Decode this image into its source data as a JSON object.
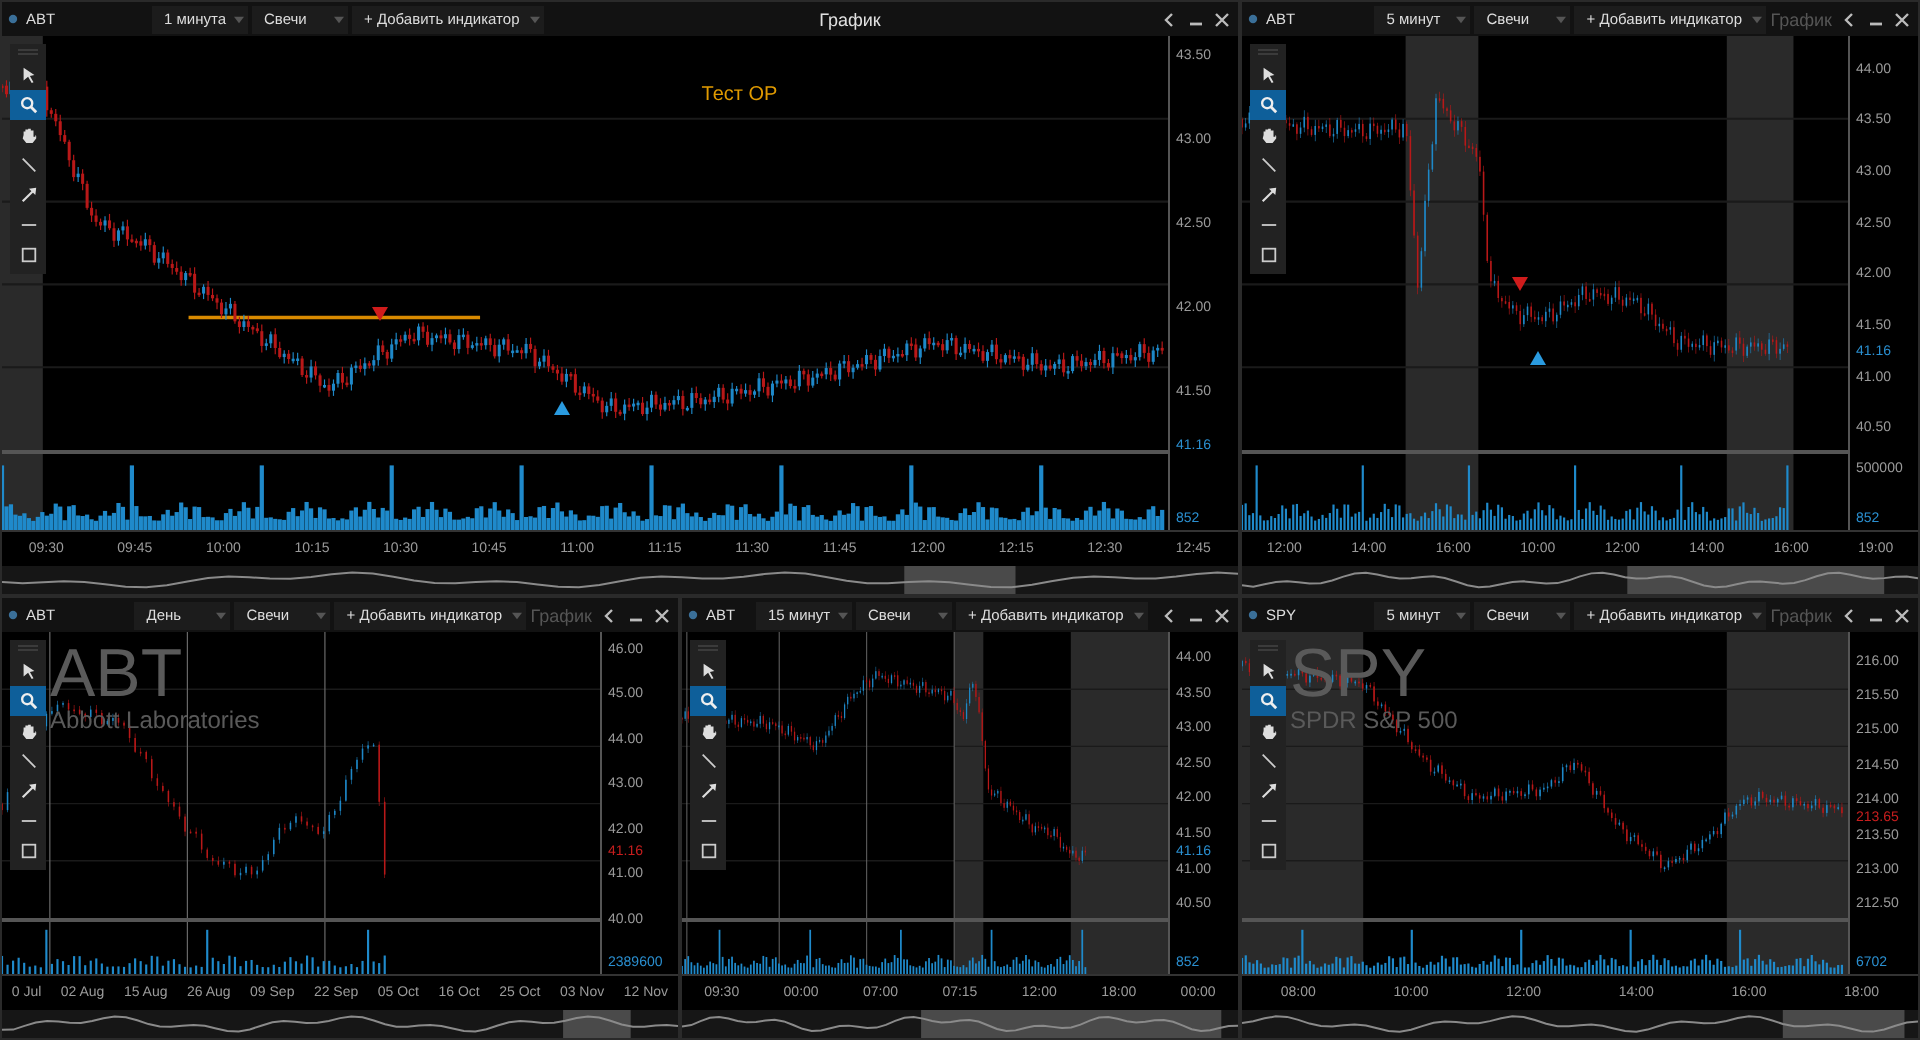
{
  "panels": [
    {
      "symbol": "ABT",
      "interval": "1 минута",
      "chart_type": "Свечи",
      "add_indicator": "+ Добавить индикатор",
      "title": "График",
      "focused": true,
      "tools": [
        {
          "kind": "cursor",
          "selected": false
        },
        {
          "kind": "zoom",
          "selected": true
        },
        {
          "kind": "hand",
          "selected": false
        },
        {
          "kind": "line",
          "selected": false
        },
        {
          "kind": "arrow",
          "selected": false
        },
        {
          "kind": "hline",
          "selected": false
        },
        {
          "kind": "rect",
          "selected": false
        }
      ],
      "price_ticks": [
        "43.50",
        "43.00",
        "42.50",
        "42.00",
        "41.50"
      ],
      "last_price": {
        "text": "41.16",
        "falling": false
      },
      "volume_ticks": [
        "852"
      ],
      "time_ticks": [
        "09:30",
        "09:45",
        "10:00",
        "10:15",
        "10:30",
        "10:45",
        "11:00",
        "11:15",
        "11:30",
        "11:45",
        "12:00",
        "12:15",
        "12:30",
        "12:45"
      ],
      "annotation": "Тест OP"
    },
    {
      "symbol": "ABT",
      "interval": "5 минут",
      "chart_type": "Свечи",
      "add_indicator": "+ Добавить индикатор",
      "title": "График",
      "focused": false,
      "tools": [
        {
          "kind": "cursor",
          "selected": false
        },
        {
          "kind": "zoom",
          "selected": true
        },
        {
          "kind": "hand",
          "selected": false
        },
        {
          "kind": "line",
          "selected": false
        },
        {
          "kind": "arrow",
          "selected": false
        },
        {
          "kind": "hline",
          "selected": false
        },
        {
          "kind": "rect",
          "selected": false
        }
      ],
      "price_ticks": [
        "44.00",
        "43.50",
        "43.00",
        "42.50",
        "42.00",
        "41.50",
        "41.00",
        "40.50"
      ],
      "last_price": {
        "text": "41.16",
        "falling": false
      },
      "volume_ticks": [
        "500000",
        "852"
      ],
      "time_ticks": [
        "12:00",
        "14:00",
        "16:00",
        "10:00",
        "12:00",
        "14:00",
        "16:00",
        "19:00"
      ]
    },
    {
      "symbol": "ABT",
      "interval": "День",
      "chart_type": "Свечи",
      "add_indicator": "+ Добавить индикатор",
      "title": "График",
      "focused": false,
      "tools": [
        {
          "kind": "cursor",
          "selected": false
        },
        {
          "kind": "zoom",
          "selected": true
        },
        {
          "kind": "hand",
          "selected": false
        },
        {
          "kind": "line",
          "selected": false
        },
        {
          "kind": "arrow",
          "selected": false
        },
        {
          "kind": "hline",
          "selected": false
        },
        {
          "kind": "rect",
          "selected": false
        }
      ],
      "watermark": {
        "symbol": "ABT",
        "name": "Abbott Laboratories"
      },
      "price_ticks": [
        "46.00",
        "45.00",
        "44.00",
        "43.00",
        "42.00",
        "41.00",
        "40.00"
      ],
      "last_price": {
        "text": "41.16",
        "falling": true
      },
      "volume_ticks": [
        "2389600"
      ],
      "time_ticks": [
        "0 Jul",
        "02 Aug",
        "15 Aug",
        "26 Aug",
        "09 Sep",
        "22 Sep",
        "05 Oct",
        "16 Oct",
        "25 Oct",
        "03 Nov",
        "12 Nov"
      ]
    },
    {
      "symbol": "ABT",
      "interval": "15 минут",
      "chart_type": "Свечи",
      "add_indicator": "+ Добавить индикатор",
      "tools": [
        {
          "kind": "cursor",
          "selected": false
        },
        {
          "kind": "zoom",
          "selected": true
        },
        {
          "kind": "hand",
          "selected": false
        },
        {
          "kind": "line",
          "selected": false
        },
        {
          "kind": "arrow",
          "selected": false
        },
        {
          "kind": "hline",
          "selected": false
        },
        {
          "kind": "rect",
          "selected": false
        }
      ],
      "price_ticks": [
        "44.00",
        "43.50",
        "43.00",
        "42.50",
        "42.00",
        "41.50",
        "41.00",
        "40.50"
      ],
      "last_price": {
        "text": "41.16",
        "falling": false
      },
      "volume_ticks": [
        "852"
      ],
      "time_ticks": [
        "09:30",
        "00:00",
        "07:00",
        "07:15",
        "12:00",
        "18:00",
        "00:00"
      ]
    },
    {
      "symbol": "SPY",
      "interval": "5 минут",
      "chart_type": "Свечи",
      "add_indicator": "+ Добавить индикатор",
      "title": "График",
      "focused": false,
      "tools": [
        {
          "kind": "cursor",
          "selected": false
        },
        {
          "kind": "zoom",
          "selected": true
        },
        {
          "kind": "hand",
          "selected": false
        },
        {
          "kind": "line",
          "selected": false
        },
        {
          "kind": "arrow",
          "selected": false
        },
        {
          "kind": "hline",
          "selected": false
        },
        {
          "kind": "rect",
          "selected": false
        }
      ],
      "watermark": {
        "symbol": "SPY",
        "name": "SPDR S&P 500"
      },
      "price_ticks": [
        "216.00",
        "215.50",
        "215.00",
        "214.50",
        "214.00",
        "213.50",
        "213.00",
        "212.50"
      ],
      "last_price": {
        "text": "213.65",
        "falling": true
      },
      "volume_ticks": [
        "6702"
      ],
      "time_ticks": [
        "08:00",
        "10:00",
        "12:00",
        "14:00",
        "16:00",
        "18:00"
      ]
    }
  ]
}
